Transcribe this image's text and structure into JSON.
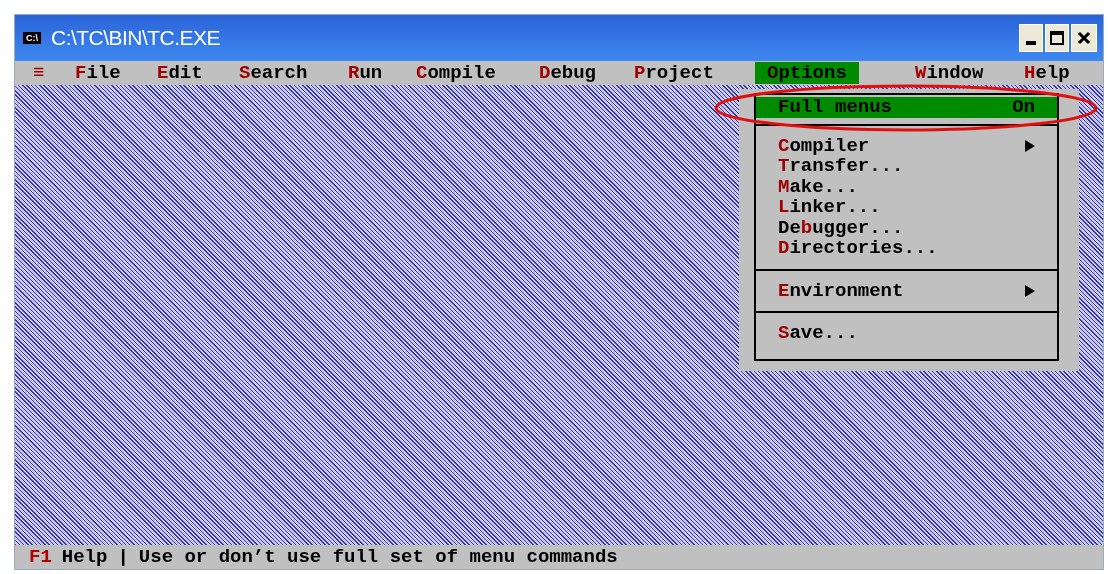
{
  "window": {
    "title": "C:\\TC\\BIN\\TC.EXE",
    "icon_label": "C:\\"
  },
  "menu_bar": [
    {
      "key": "≡",
      "selected": false
    },
    {
      "key": "F",
      "post": "ile",
      "selected": false
    },
    {
      "key": "E",
      "post": "dit",
      "selected": false
    },
    {
      "key": "S",
      "post": "earch",
      "selected": false
    },
    {
      "key": "R",
      "post": "un",
      "selected": false
    },
    {
      "key": "C",
      "post": "ompile",
      "selected": false
    },
    {
      "key": "D",
      "post": "ebug",
      "selected": false
    },
    {
      "key": "P",
      "post": "roject",
      "selected": false
    },
    {
      "key": "O",
      "post": "ptions",
      "selected": true
    },
    {
      "key": "W",
      "post": "indow",
      "selected": false
    },
    {
      "key": "H",
      "post": "elp",
      "selected": false
    }
  ],
  "options_menu": [
    [
      {
        "key": "F",
        "post": "ull menus",
        "value": "On",
        "submenu": false,
        "selected": true
      }
    ],
    [
      {
        "key": "C",
        "post": "ompiler",
        "submenu": true,
        "selected": false
      },
      {
        "key": "T",
        "post": "ransfer...",
        "submenu": false,
        "selected": false
      },
      {
        "key": "M",
        "post": "ake...",
        "submenu": false,
        "selected": false
      },
      {
        "key": "L",
        "post": "inker...",
        "submenu": false,
        "selected": false
      },
      {
        "pre": "De",
        "key": "b",
        "post": "ugger...",
        "submenu": false,
        "selected": false
      },
      {
        "key": "D",
        "post": "irectories...",
        "submenu": false,
        "selected": false
      }
    ],
    [
      {
        "key": "E",
        "post": "nvironment",
        "submenu": true,
        "selected": false
      }
    ],
    [
      {
        "key": "S",
        "post": "ave...",
        "submenu": false,
        "selected": false
      }
    ]
  ],
  "status_bar": {
    "key": "F1",
    "label": "Help",
    "separator": "|",
    "message": "Use or don’t use full set of menu commands"
  }
}
